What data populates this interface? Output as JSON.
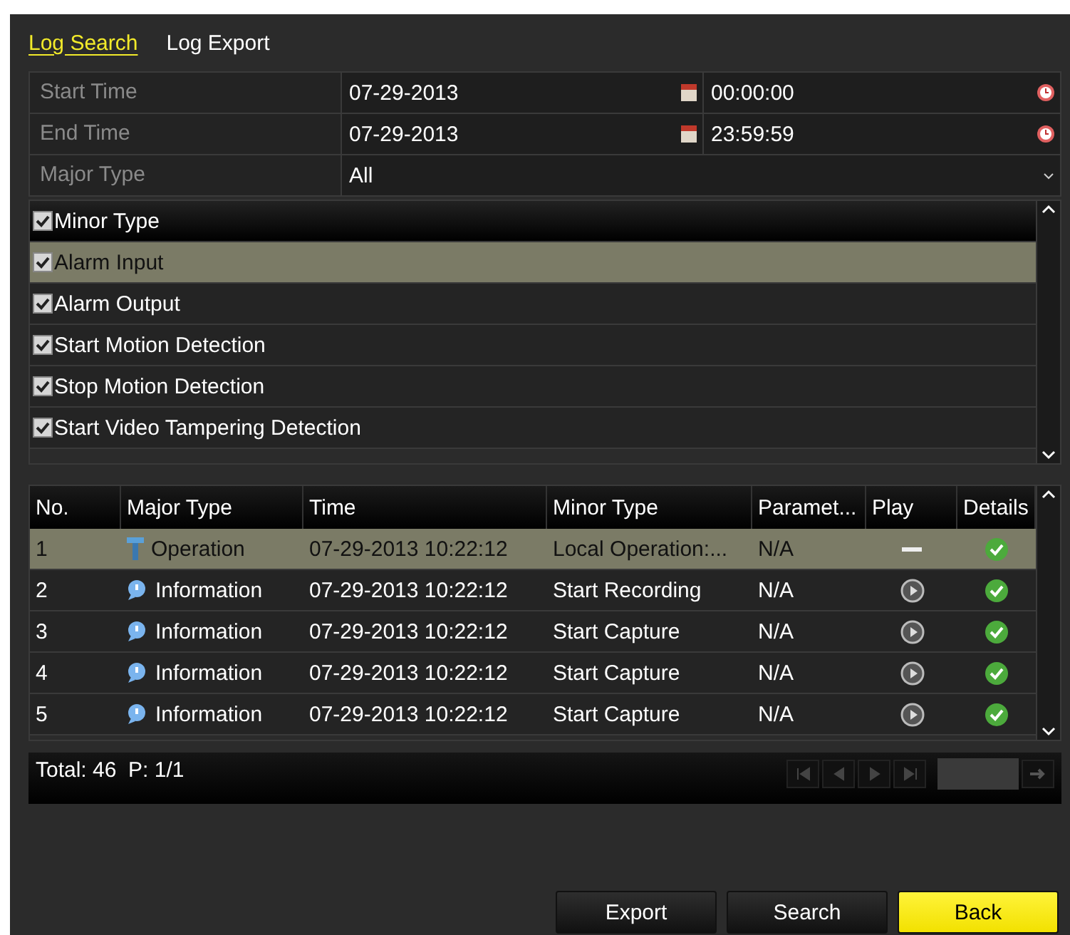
{
  "tabs": [
    {
      "label": "Log Search",
      "selected": true
    },
    {
      "label": "Log Export",
      "selected": false
    }
  ],
  "form": [
    {
      "label": "Start Time",
      "date": "07-29-2013",
      "time": "00:00:00"
    },
    {
      "label": "End Time",
      "date": "07-29-2013",
      "time": "23:59:59"
    }
  ],
  "major_type": {
    "label": "Major Type",
    "value": "All"
  },
  "minor_types": [
    {
      "label": "Minor Type",
      "kind": "header",
      "checked": true,
      "selected": false
    },
    {
      "label": "Alarm Input",
      "kind": "item",
      "checked": true,
      "selected": true
    },
    {
      "label": "Alarm Output",
      "kind": "item",
      "checked": true,
      "selected": false
    },
    {
      "label": "Start Motion Detection",
      "kind": "item",
      "checked": true,
      "selected": false
    },
    {
      "label": "Stop Motion Detection",
      "kind": "item",
      "checked": true,
      "selected": false
    },
    {
      "label": "Start Video Tampering Detection",
      "kind": "item",
      "checked": true,
      "selected": false
    }
  ],
  "table": {
    "columns": [
      "No.",
      "Major Type",
      "Time",
      "Minor Type",
      "Paramet...",
      "Play",
      "Details"
    ],
    "rows": [
      {
        "no": "1",
        "kind": "operation",
        "major": "Operation",
        "time": "07-29-2013 10:22:12",
        "minor": "Local Operation:...",
        "param": "N/A",
        "playable": false,
        "selected": true
      },
      {
        "no": "2",
        "kind": "information",
        "major": "Information",
        "time": "07-29-2013 10:22:12",
        "minor": "Start Recording",
        "param": "N/A",
        "playable": true,
        "selected": false
      },
      {
        "no": "3",
        "kind": "information",
        "major": "Information",
        "time": "07-29-2013 10:22:12",
        "minor": "Start Capture",
        "param": "N/A",
        "playable": true,
        "selected": false
      },
      {
        "no": "4",
        "kind": "information",
        "major": "Information",
        "time": "07-29-2013 10:22:12",
        "minor": "Start Capture",
        "param": "N/A",
        "playable": true,
        "selected": false
      },
      {
        "no": "5",
        "kind": "information",
        "major": "Information",
        "time": "07-29-2013 10:22:12",
        "minor": "Start Capture",
        "param": "N/A",
        "playable": true,
        "selected": false
      }
    ]
  },
  "footer": {
    "total": "Total: 46  P: 1/1"
  },
  "buttons": [
    {
      "label": "Export",
      "primary": false
    },
    {
      "label": "Search",
      "primary": false
    },
    {
      "label": "Back",
      "primary": true
    }
  ]
}
